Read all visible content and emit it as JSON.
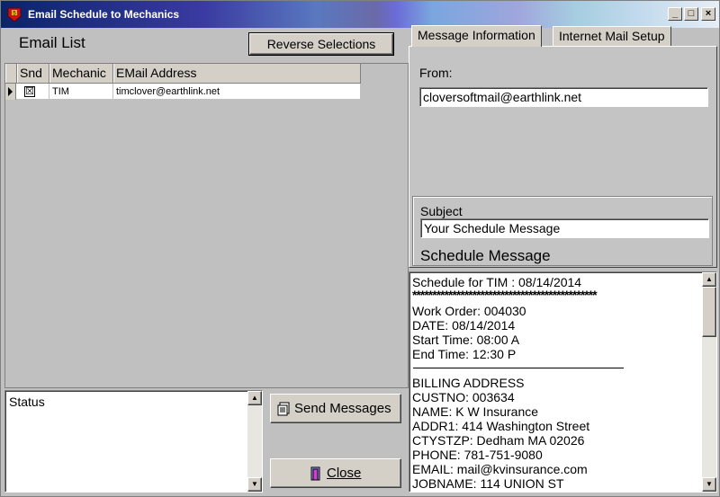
{
  "window": {
    "title": "Email Schedule to Mechanics",
    "minimize": "_",
    "maximize": "□",
    "close": "×"
  },
  "email_list": {
    "label": "Email List",
    "reverse_button": "Reverse Selections",
    "columns": [
      "Snd",
      "Mechanic",
      "EMail Address"
    ],
    "rows": [
      {
        "snd": "☒",
        "mechanic": "TIM",
        "email": "timclover@earthlink.net"
      }
    ]
  },
  "status": {
    "label": "Status"
  },
  "buttons": {
    "send": "Send Messages",
    "close": "Close"
  },
  "tabs": [
    {
      "label": "Message Information",
      "active": true
    },
    {
      "label": "Internet Mail Setup",
      "active": false
    }
  ],
  "message_info": {
    "from_label": "From:",
    "from_value": "cloversoftmail@earthlink.net",
    "subject_label": "Subject",
    "subject_value": "Your Schedule Message",
    "schedule_label": "Schedule Message"
  },
  "message_body": [
    "Schedule for TIM : 08/14/2014",
    "**********************************************",
    "",
    "Work Order: 004030",
    "DATE: 08/14/2014",
    "Start Time: 08:00 A",
    "End Time: 12:30 P",
    "",
    "BILLING ADDRESS",
    "CUSTNO: 003634",
    "NAME: K W Insurance",
    "ADDR1: 414 Washington Street",
    "CTYSTZP: Dedham MA 02026",
    "PHONE: 781-751-9080",
    "EMAIL: mail@kvinsurance.com",
    "JOBNAME: 114 UNION ST"
  ]
}
